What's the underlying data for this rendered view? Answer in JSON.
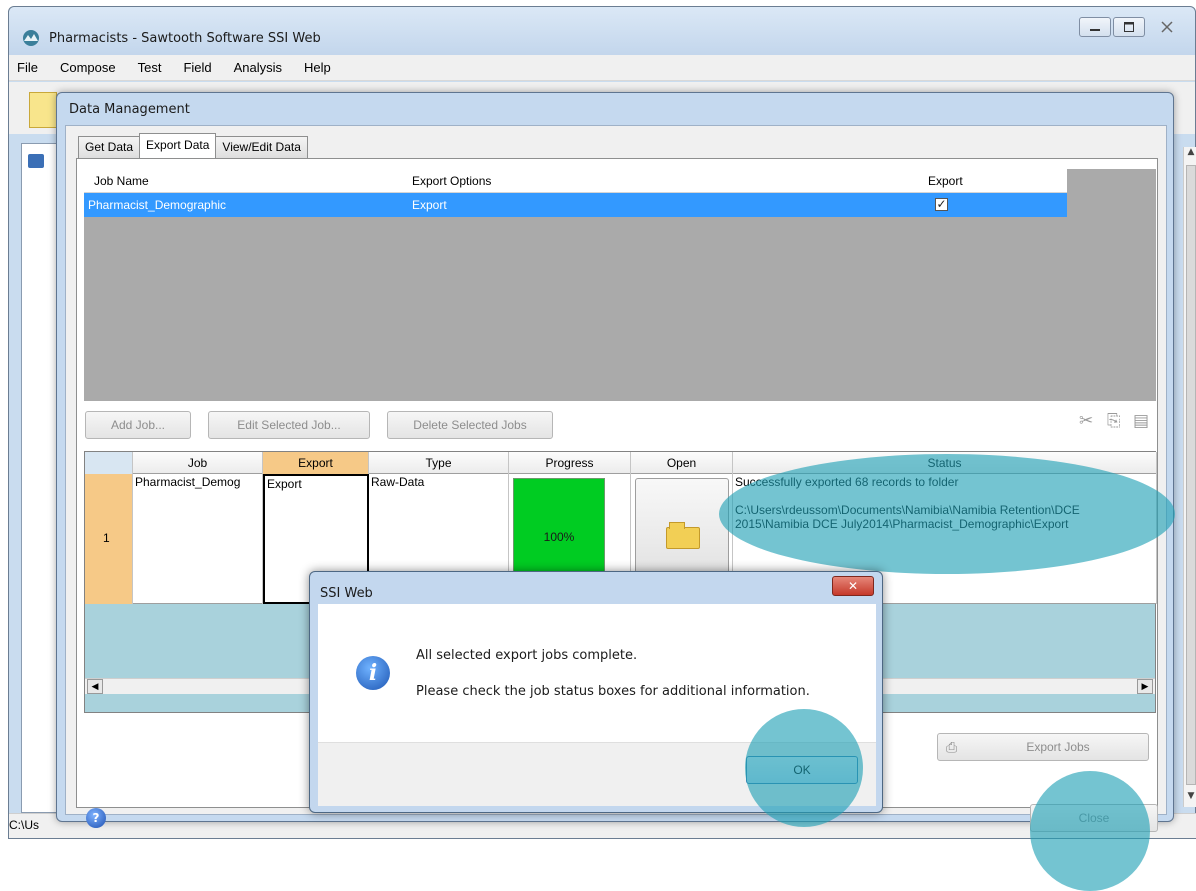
{
  "main_window": {
    "title": "Pharmacists - Sawtooth Software SSI Web",
    "menu": [
      "File",
      "Compose",
      "Test",
      "Field",
      "Analysis",
      "Help"
    ],
    "status_path": "C:\\Us"
  },
  "data_management": {
    "title": "Data Management",
    "tabs": [
      {
        "label": "Get Data",
        "active": false
      },
      {
        "label": "Export Data",
        "active": true
      },
      {
        "label": "View/Edit Data",
        "active": false
      }
    ],
    "jobs_table": {
      "headers": [
        "Job Name",
        "Export Options",
        "Export"
      ],
      "rows": [
        {
          "job_name": "Pharmacist_Demographic",
          "export_options": "Export",
          "export_checked": true,
          "check_mark": "✓"
        }
      ]
    },
    "buttons": {
      "add_job": "Add Job...",
      "edit_selected_job": "Edit Selected Job...",
      "delete_selected_jobs": "Delete Selected Jobs",
      "export_jobs": "Export Jobs",
      "close": "Close",
      "help": "?"
    },
    "export_grid": {
      "headers": [
        "Job",
        "Export",
        "Type",
        "Progress",
        "Open",
        "Status"
      ],
      "row": {
        "row_number": "1",
        "job": "Pharmacist_Demog",
        "export": "Export",
        "type": "Raw-Data",
        "progress_label": "100%",
        "progress_fraction": 1.0,
        "status_line1": "Successfully exported 68 records to folder",
        "status_line2": "C:\\Users\\rdeussom\\Documents\\Namibia\\Namibia Retention\\DCE 2015\\Namibia  DCE  July2014\\Pharmacist_Demographic\\Export"
      }
    }
  },
  "message_box": {
    "title": "SSI Web",
    "close_symbol": "✕",
    "info_symbol": "i",
    "line1": "All selected export jobs complete.",
    "line2": "Please check the job status boxes for additional information.",
    "ok_label": "OK"
  },
  "colors": {
    "selection": "#3399ff",
    "progress": "#00cc22",
    "highlight": "#1ea0b4"
  }
}
